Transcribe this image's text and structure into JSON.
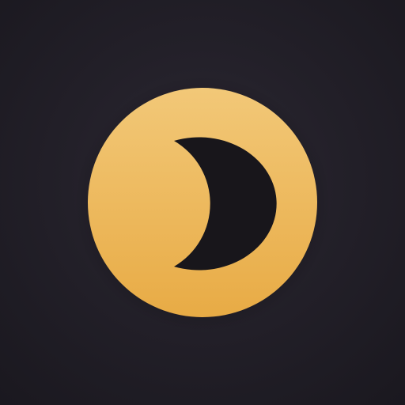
{
  "app_icon": {
    "name": "moon-app-icon",
    "icon": "moon-icon",
    "colors": {
      "background_dark": "#1a181f",
      "background_mid": "#2c2833",
      "disc_top": "#f2c878",
      "disc_bottom": "#e8ab45",
      "crescent": "#18161b"
    }
  }
}
